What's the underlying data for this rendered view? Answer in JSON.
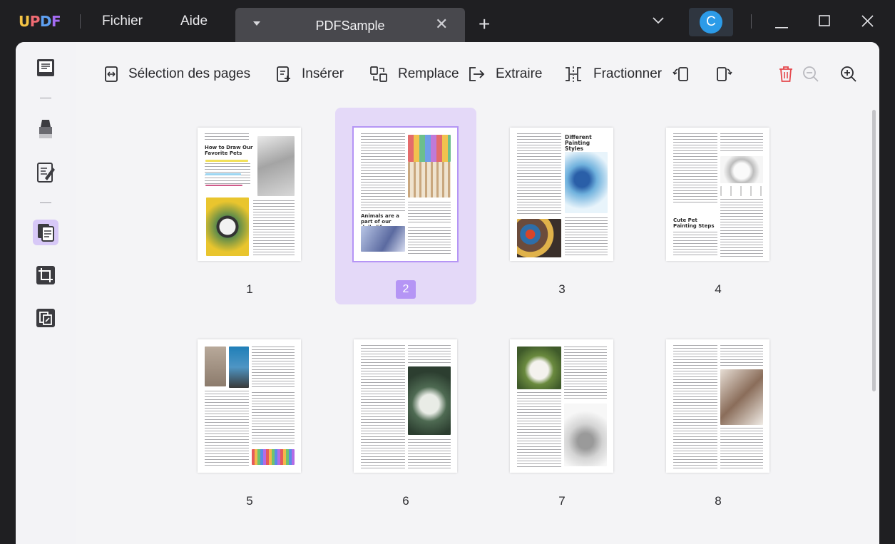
{
  "app": {
    "logo_letters": [
      "U",
      "P",
      "D",
      "F"
    ],
    "menu": [
      "Fichier",
      "Aide"
    ],
    "tab_title": "PDFSample",
    "new_tab": "+",
    "tab_close": "✕",
    "user_initial": "C"
  },
  "toolbar": {
    "page_selection": "Sélection des pages",
    "insert": "Insérer",
    "replace": "Remplace",
    "extract": "Extraire",
    "split": "Fractionner"
  },
  "pages": [
    {
      "number": "1",
      "heading": "How to Draw Our Favorite Pets"
    },
    {
      "number": "2",
      "heading": "Animals are a part of our daily life"
    },
    {
      "number": "3",
      "heading": "Different Painting Styles"
    },
    {
      "number": "4",
      "heading": "Cute Pet Painting Steps"
    },
    {
      "number": "5"
    },
    {
      "number": "6"
    },
    {
      "number": "7"
    },
    {
      "number": "8"
    }
  ],
  "selected_page": "2",
  "colors": {
    "accent": "#b595f5",
    "selection_bg": "#e4d9f8",
    "delete_red": "#e5484d"
  }
}
